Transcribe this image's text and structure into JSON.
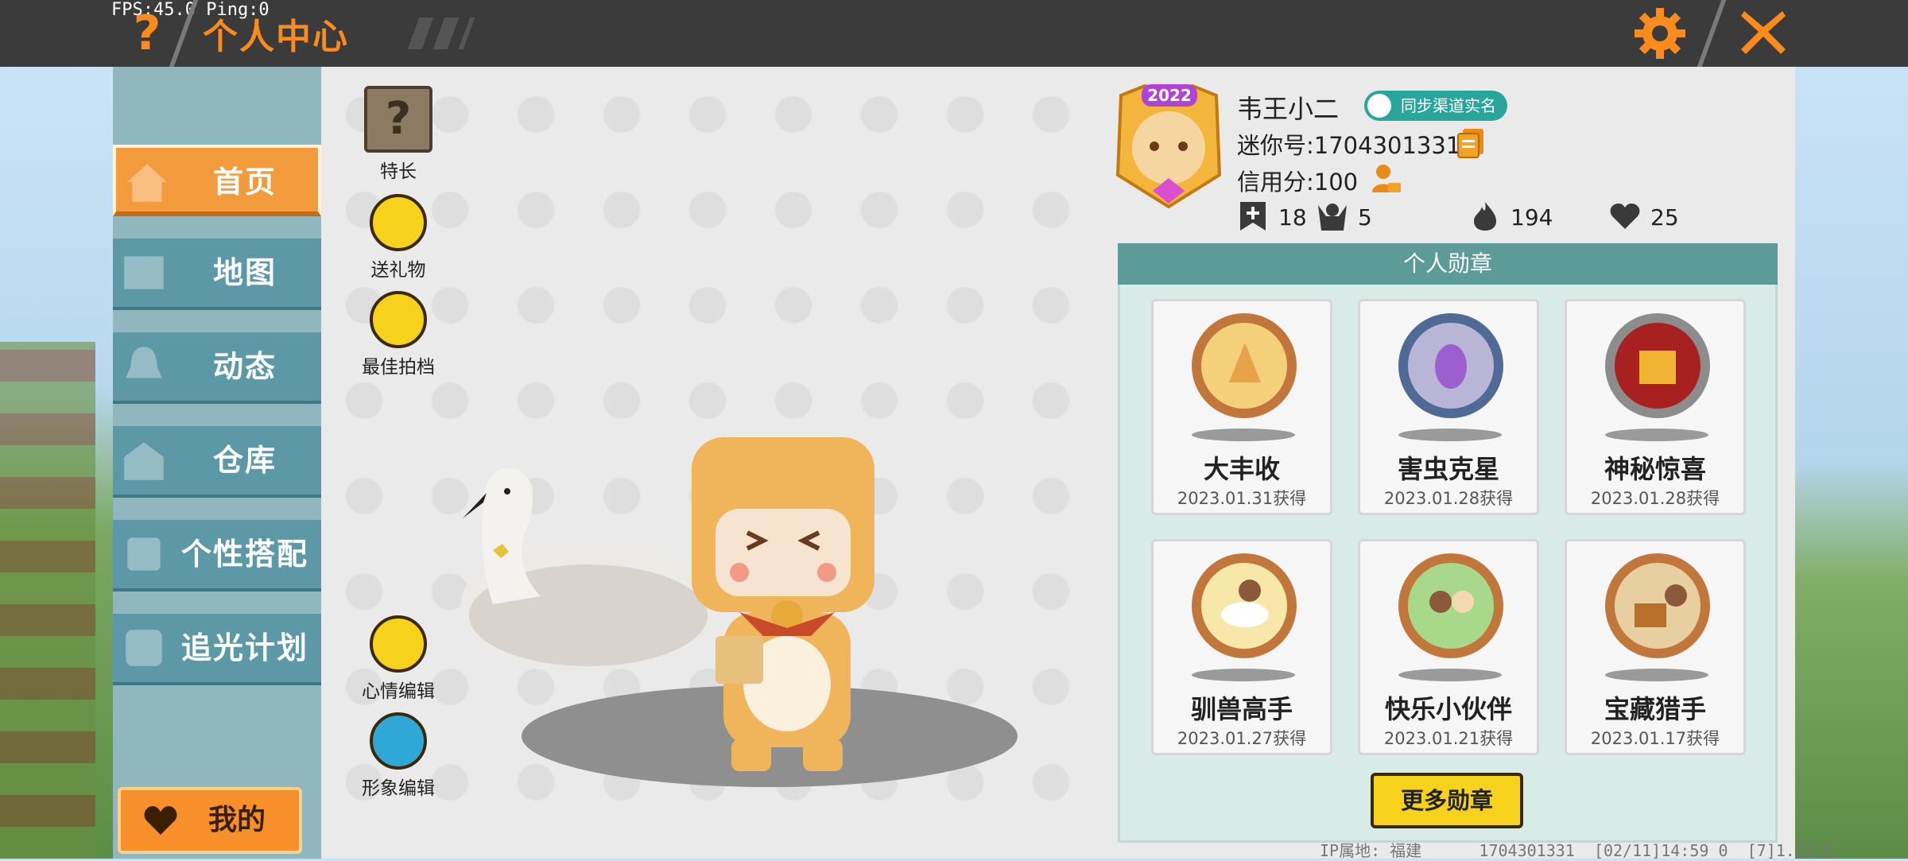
{
  "overlay": {
    "fps_text": "FPS:45.0  Ping:0"
  },
  "header": {
    "title": "个人中心",
    "help_icon": "question-icon",
    "settings_icon": "gear-icon",
    "close_icon": "close-icon",
    "accent_color": "#ff8a1e"
  },
  "sidebar": {
    "items": [
      {
        "label": "首页",
        "icon": "home-icon",
        "active": true
      },
      {
        "label": "地图",
        "icon": "map-icon"
      },
      {
        "label": "动态",
        "icon": "bell-icon"
      },
      {
        "label": "仓库",
        "icon": "warehouse-icon"
      },
      {
        "label": "个性搭配",
        "icon": "outfit-icon"
      },
      {
        "label": "追光计划",
        "icon": "plan-icon"
      }
    ],
    "mine_label": "我的"
  },
  "actions": {
    "talent": "特长",
    "gift": "送礼物",
    "partner": "最佳拍档",
    "mood": "心情编辑",
    "appearance": "形象编辑"
  },
  "profile": {
    "avatar_badge": "2022",
    "name": "韦王小二",
    "realname_badge": "同步渠道实名",
    "mini_id": "迷你号:1704301331",
    "credit": "信用分:100",
    "stats": {
      "add_friends": "18",
      "fans": "5",
      "popularity": "194",
      "likes": "25"
    }
  },
  "medals": {
    "title": "个人勋章",
    "items": [
      {
        "name": "大丰收",
        "date": "2023.01.31获得"
      },
      {
        "name": "害虫克星",
        "date": "2023.01.28获得"
      },
      {
        "name": "神秘惊喜",
        "date": "2023.01.28获得"
      },
      {
        "name": "驯兽高手",
        "date": "2023.01.27获得"
      },
      {
        "name": "快乐小伙伴",
        "date": "2023.01.21获得"
      },
      {
        "name": "宝藏猎手",
        "date": "2023.01.17获得"
      }
    ],
    "more_label": "更多勋章"
  },
  "footer": {
    "ip": "IP属地: 福建",
    "uid": "1704301331",
    "time": "[02/11]14:59 0",
    "version": "[7]1.23.5"
  }
}
